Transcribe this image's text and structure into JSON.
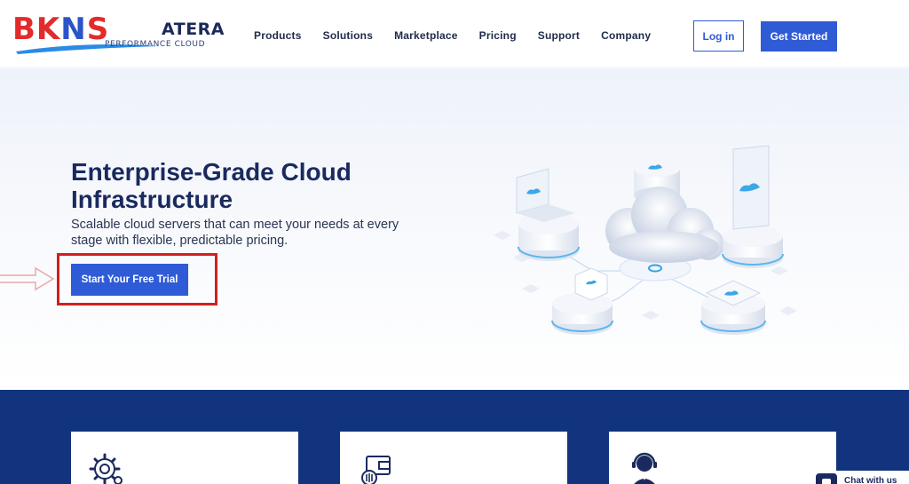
{
  "brand": {
    "logo_text_b": "BK",
    "logo_text_n": "N",
    "logo_text_s": "S",
    "wordmark": "ATERA",
    "tagline": "PERFORMANCE CLOUD"
  },
  "nav": {
    "items": [
      "Products",
      "Solutions",
      "Marketplace",
      "Pricing",
      "Support",
      "Company"
    ]
  },
  "header": {
    "login_label": "Log in",
    "get_started_label": "Get Started"
  },
  "hero": {
    "title": "Enterprise-Grade Cloud Infrastructure",
    "subtitle": "Scalable cloud servers that can meet your needs at every stage with flexible, predictable pricing.",
    "cta_label": "Start Your Free Trial"
  },
  "features": {
    "icons": [
      "gear-icon",
      "wallet-icon",
      "support-agent-icon"
    ]
  },
  "chat": {
    "label": "Chat with us"
  },
  "colors": {
    "primary": "#2f5bd6",
    "navy": "#12347e",
    "title": "#1a2a5e",
    "highlight": "#d21f1f",
    "logo_red": "#e32b2b"
  }
}
